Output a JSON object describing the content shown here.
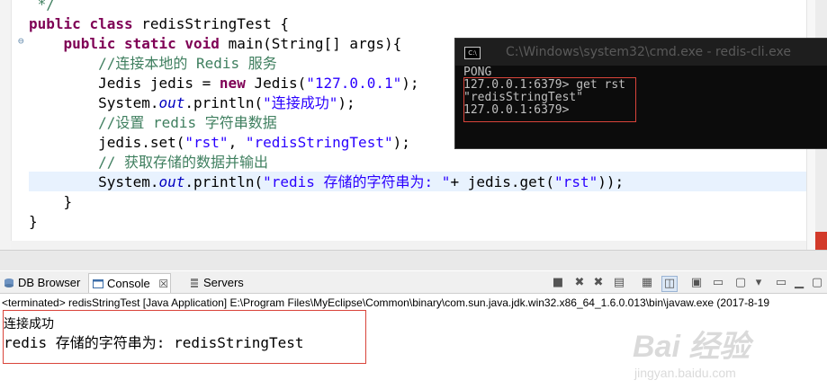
{
  "editor": {
    "lines": [
      {
        "segments": [
          {
            "t": " */",
            "c": "cmt"
          }
        ]
      },
      {
        "segments": [
          {
            "t": "public",
            "c": "kw"
          },
          {
            "t": " "
          },
          {
            "t": "class",
            "c": "kw"
          },
          {
            "t": " redisStringTest {"
          }
        ]
      },
      {
        "segments": [
          {
            "t": "    "
          },
          {
            "t": "public",
            "c": "kw"
          },
          {
            "t": " "
          },
          {
            "t": "static",
            "c": "kw"
          },
          {
            "t": " "
          },
          {
            "t": "void",
            "c": "kw"
          },
          {
            "t": " main(String[] args){"
          }
        ]
      },
      {
        "segments": [
          {
            "t": "        "
          },
          {
            "t": "//连接本地的 Redis 服务",
            "c": "cmt"
          }
        ]
      },
      {
        "segments": [
          {
            "t": "        Jedis jedis = "
          },
          {
            "t": "new",
            "c": "kw"
          },
          {
            "t": " Jedis("
          },
          {
            "t": "\"127.0.0.1\"",
            "c": "str"
          },
          {
            "t": ");"
          }
        ]
      },
      {
        "segments": [
          {
            "t": "        System."
          },
          {
            "t": "out",
            "c": "fld"
          },
          {
            "t": ".println("
          },
          {
            "t": "\"连接成功\"",
            "c": "str"
          },
          {
            "t": ");"
          }
        ]
      },
      {
        "segments": [
          {
            "t": "        "
          },
          {
            "t": "//设置 redis 字符串数据",
            "c": "cmt"
          }
        ]
      },
      {
        "segments": [
          {
            "t": "        jedis.set("
          },
          {
            "t": "\"rst\"",
            "c": "str"
          },
          {
            "t": ", "
          },
          {
            "t": "\"redisStringTest\"",
            "c": "str"
          },
          {
            "t": ");"
          }
        ]
      },
      {
        "segments": [
          {
            "t": "        "
          },
          {
            "t": "// 获取存储的数据并输出",
            "c": "cmt"
          }
        ]
      },
      {
        "segments": [
          {
            "t": "        System."
          },
          {
            "t": "out",
            "c": "fld"
          },
          {
            "t": ".println("
          },
          {
            "t": "\"redis 存储的字符串为: \"",
            "c": "str"
          },
          {
            "t": "+ jedis.get("
          },
          {
            "t": "\"rst\"",
            "c": "str"
          },
          {
            "t": "));"
          }
        ]
      },
      {
        "segments": [
          {
            "t": "    }"
          }
        ]
      },
      {
        "segments": [
          {
            "t": "}"
          }
        ]
      }
    ]
  },
  "cmd": {
    "icon_label": "C:\\",
    "title": "C:\\Windows\\system32\\cmd.exe - redis-cli.exe",
    "lines": [
      "PONG",
      "127.0.0.1:6379> get rst",
      "\"redisStringTest\"",
      "127.0.0.1:6379>"
    ]
  },
  "panel": {
    "tabs": [
      {
        "label": "DB Browser",
        "icon": "db-browser-icon"
      },
      {
        "label": "Console",
        "icon": "console-icon",
        "close": "☒"
      },
      {
        "label": "Servers",
        "icon": "servers-icon"
      }
    ]
  },
  "toolbar_icons": [
    "x-gray-icon",
    "remove-all-icon",
    "clear-console-icon",
    "scroll-lock-icon",
    "pin-icon",
    "display-icon",
    "open-console-icon",
    "dropdown-icon",
    "minimize-icon",
    "maximize-icon"
  ],
  "console": {
    "terminated": "<terminated> redisStringTest [Java Application] E:\\Program Files\\MyEclipse\\Common\\binary\\com.sun.java.jdk.win32.x86_64_1.6.0.013\\bin\\javaw.exe (2017-8-19",
    "output": [
      "连接成功",
      "redis 存储的字符串为: redisStringTest"
    ]
  },
  "watermark": {
    "big": "Bai 经验",
    "small": "jingyan.baidu.com"
  },
  "colors": {
    "keyword": "#7f0055",
    "string": "#2a00ff",
    "comment": "#3f7f5f",
    "highlight_box": "#d9443a"
  }
}
